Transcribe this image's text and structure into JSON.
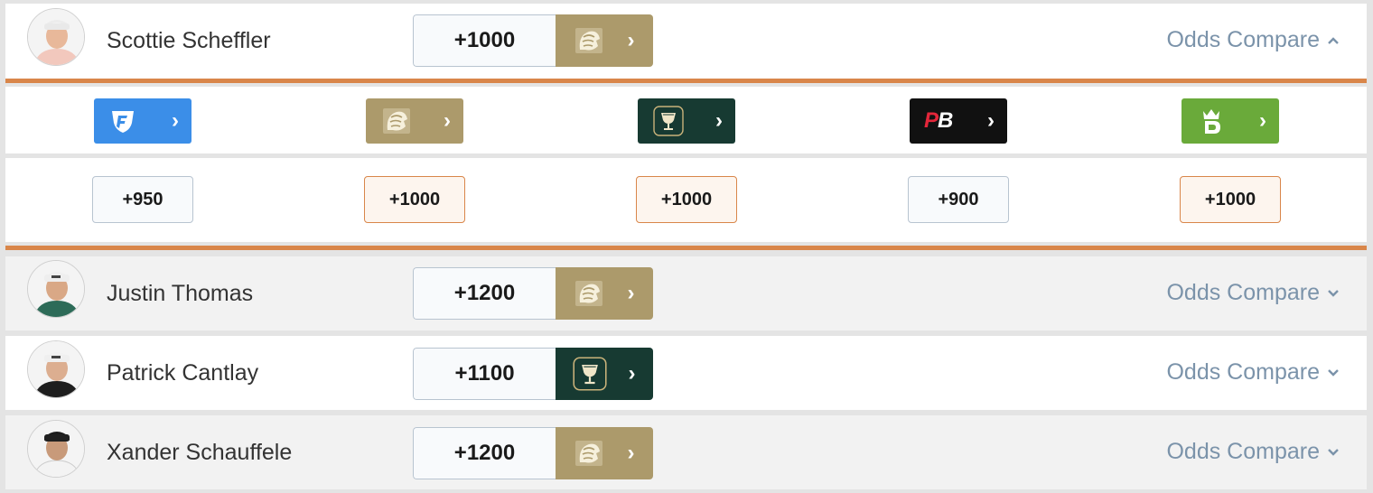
{
  "colors": {
    "accent": "#d9864a",
    "link": "#7b93aa",
    "fanduel": "#3b8ee8",
    "betmgm": "#ac9a6b",
    "caesars": "#173a32",
    "pointsbet": "#111111",
    "draftkings": "#6aaa3a"
  },
  "players": [
    {
      "name": "Scottie Scheffler",
      "best_odds": "+1000",
      "book_icon": "betmgm-lion-icon",
      "compare_label": "Odds Compare",
      "expanded": true
    },
    {
      "name": "Justin Thomas",
      "best_odds": "+1200",
      "book_icon": "betmgm-lion-icon",
      "compare_label": "Odds Compare",
      "expanded": false
    },
    {
      "name": "Patrick Cantlay",
      "best_odds": "+1100",
      "book_icon": "caesars-chalice-icon",
      "compare_label": "Odds Compare",
      "expanded": false
    },
    {
      "name": "Xander Schauffele",
      "best_odds": "+1200",
      "book_icon": "betmgm-lion-icon",
      "compare_label": "Odds Compare",
      "expanded": false
    }
  ],
  "compare": {
    "books": [
      {
        "book": "FanDuel",
        "icon": "fanduel-shield-icon",
        "price": "+950",
        "best": false
      },
      {
        "book": "BetMGM",
        "icon": "betmgm-lion-icon",
        "price": "+1000",
        "best": true
      },
      {
        "book": "Caesars",
        "icon": "caesars-chalice-icon",
        "price": "+1000",
        "best": true
      },
      {
        "book": "PointsBet",
        "icon": "pointsbet-logo-icon",
        "logo_text": "PB",
        "price": "+900",
        "best": false
      },
      {
        "book": "DraftKings",
        "icon": "draftkings-crown-icon",
        "price": "+1000",
        "best": true
      }
    ]
  }
}
